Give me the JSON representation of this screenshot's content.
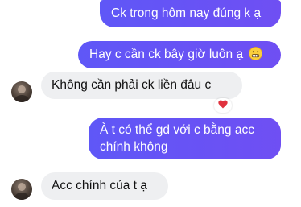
{
  "messages": [
    {
      "direction": "outgoing",
      "text": "Ck trong hôm nay đúng k ạ"
    },
    {
      "direction": "outgoing",
      "text": "Hay c cần ck bây giờ luôn ạ",
      "emoji": "grimace-emoji"
    },
    {
      "direction": "incoming",
      "text": "Không cần phải ck liền đâu c",
      "reaction": "red-heart-icon"
    },
    {
      "direction": "outgoing",
      "text_line1": "À t có thể gd với c bằng acc",
      "text_line2": "chính không"
    },
    {
      "direction": "incoming",
      "text": "Acc chính của t ạ"
    }
  ],
  "colors": {
    "outgoing_bubble": "#6a52f5",
    "incoming_bubble": "#eeeff1",
    "reaction_heart": "#e0323e"
  }
}
